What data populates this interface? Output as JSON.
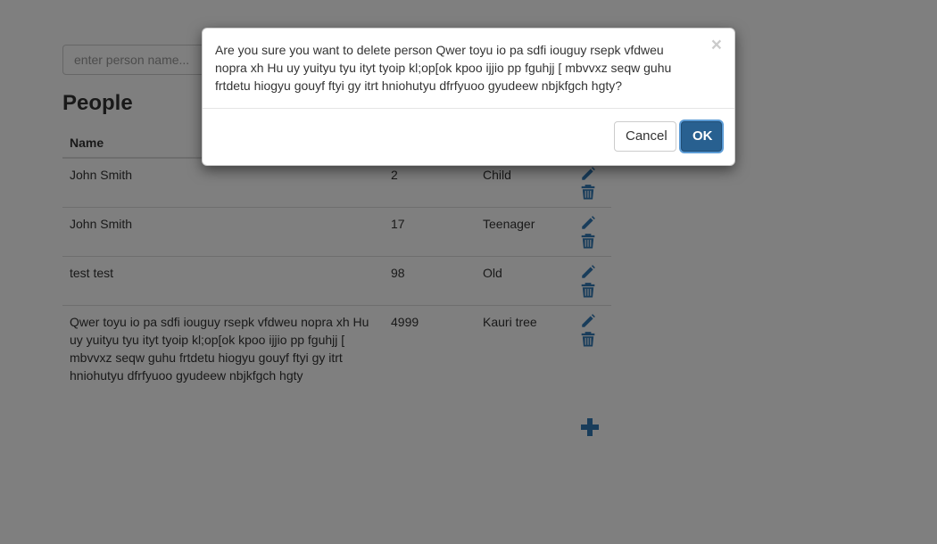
{
  "search": {
    "placeholder": "enter person name..."
  },
  "page_title": "People",
  "table": {
    "headers": [
      "Name",
      "",
      "",
      ""
    ],
    "rows": [
      {
        "name": "John Smith",
        "age": "2",
        "category": "Child"
      },
      {
        "name": "John Smith",
        "age": "17",
        "category": "Teenager"
      },
      {
        "name": "test test",
        "age": "98",
        "category": "Old"
      },
      {
        "name": "Qwer toyu io pa sdfi iouguy rsepk vfdweu nopra xh Hu uy yuityu tyu ityt tyoip kl;op[ok kpoo ijjio pp fguhjj [ mbvvxz seqw guhu frtdetu hiogyu gouyf ftyi gy itrt hniohutyu dfrfyuoo gyudeew nbjkfgch hgty",
        "age": "4999",
        "category": "Kauri tree"
      }
    ]
  },
  "modal": {
    "message": "Are you sure you want to delete person Qwer toyu io pa sdfi iouguy rsepk vfdweu nopra xh Hu uy yuityu tyu ityt tyoip kl;op[ok kpoo ijjio pp fguhjj [ mbvvxz seqw guhu frtdetu hiogyu gouyf ftyi gy itrt hniohutyu dfrfyuoo gyudeew nbjkfgch hgty?",
    "close_symbol": "×",
    "cancel_label": "Cancel",
    "ok_label": "OK"
  },
  "colors": {
    "primary": "#286090",
    "icon": "#337ab7"
  },
  "icons": {
    "edit": "pencil-icon",
    "delete": "trash-icon",
    "add": "plus-icon"
  }
}
